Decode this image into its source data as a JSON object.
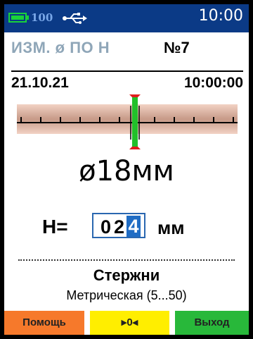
{
  "status": {
    "battery_percent": "100",
    "usb_icon": "usb-icon",
    "clock": "10:00",
    "colors": {
      "bar": "#0b3a86",
      "battery": "#19d23b"
    }
  },
  "header": {
    "mode": "ИЗМ. ø ПО H",
    "number": "№7",
    "date": "21.10.21",
    "time": "10:00:00"
  },
  "measurement": {
    "diameter": "ø18мм",
    "h_label": "H=",
    "h_digits": [
      "0",
      "2",
      "4"
    ],
    "h_active_digit_index": 2,
    "h_unit": "мм"
  },
  "material": {
    "name": "Стержни",
    "grade": "Метрическая (5...50)"
  },
  "softkeys": {
    "help": "Помощь",
    "zero": "▸0◂",
    "exit": "Выход",
    "colors": {
      "help": "#f6792b",
      "zero": "#ffee00",
      "exit": "#28b83a"
    }
  }
}
